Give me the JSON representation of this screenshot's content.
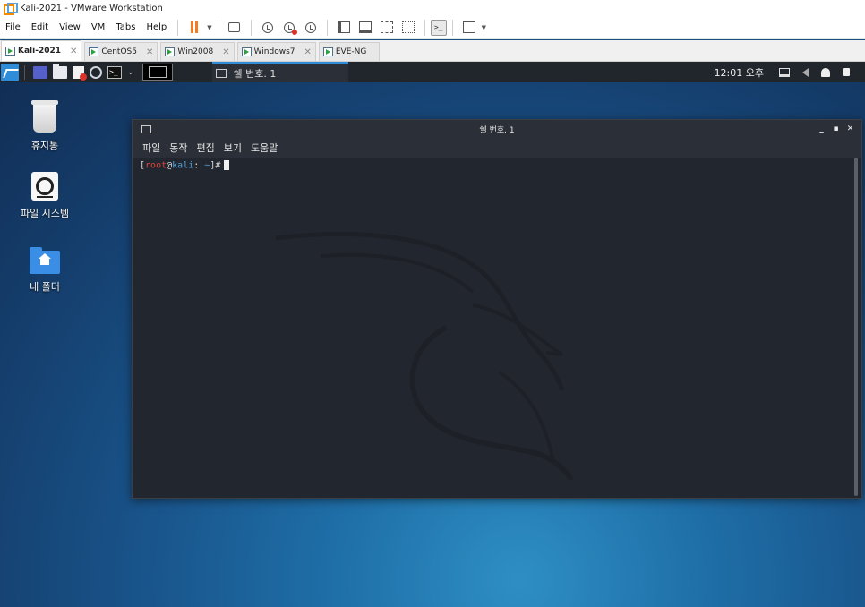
{
  "window": {
    "title": "Kali-2021 - VMware Workstation"
  },
  "menu": {
    "items": [
      "File",
      "Edit",
      "View",
      "VM",
      "Tabs",
      "Help"
    ]
  },
  "vm_tabs": [
    {
      "label": "Kali-2021",
      "active": true
    },
    {
      "label": "CentOS5",
      "active": false
    },
    {
      "label": "Win2008",
      "active": false
    },
    {
      "label": "Windows7",
      "active": false
    },
    {
      "label": "EVE-NG",
      "active": false
    }
  ],
  "panel": {
    "task_label": "쉘 번호. 1",
    "clock": "12:01 오후"
  },
  "desktop": {
    "icons": [
      {
        "label": "휴지통"
      },
      {
        "label": "파일 시스템"
      },
      {
        "label": "내 폴더"
      }
    ]
  },
  "terminal": {
    "title": "쉘 번호. 1",
    "menu": [
      "파일",
      "동작",
      "편집",
      "보기",
      "도움말"
    ],
    "prompt": {
      "open": "[",
      "user": "root",
      "at": "@",
      "host": "kali",
      "sep": ": ",
      "path": "~",
      "close": "]",
      "symbol": "#"
    }
  },
  "colors": {
    "accent": "#2f8cd8",
    "prompt_user": "#e0443a",
    "prompt_host": "#4ea3e0",
    "pause": "#f37b21"
  }
}
